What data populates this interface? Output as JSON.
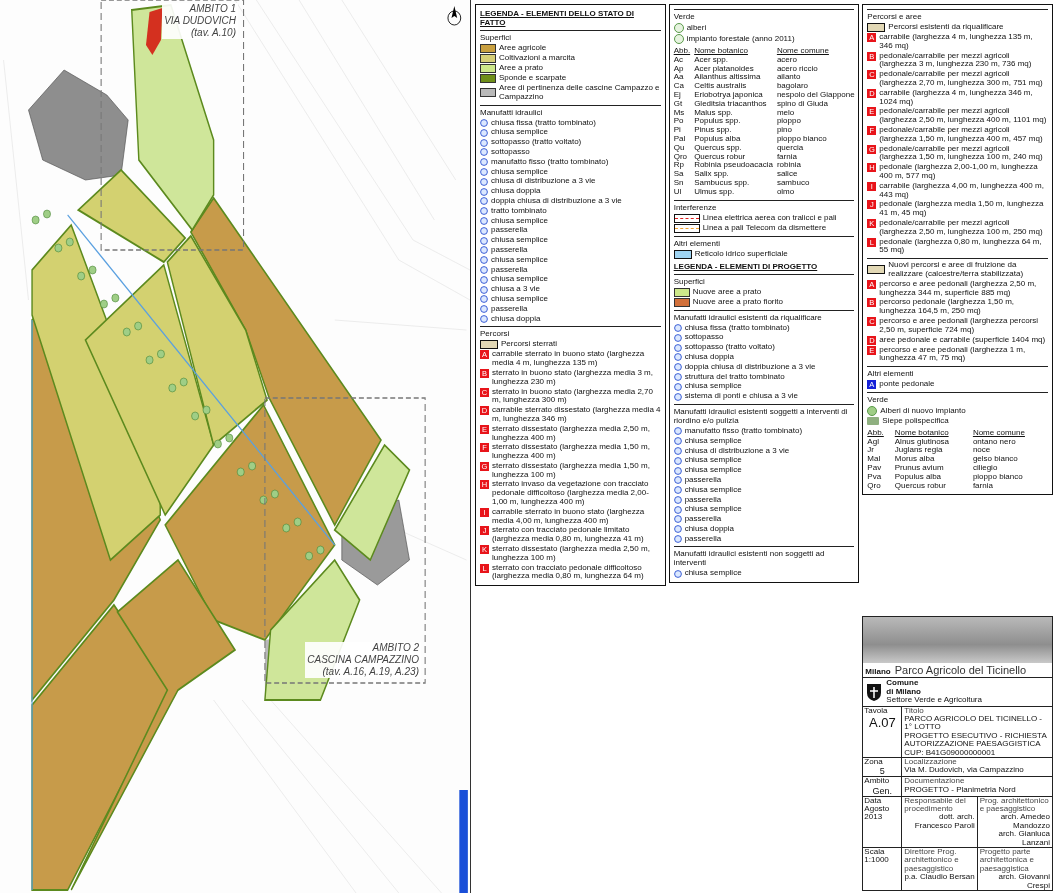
{
  "map": {
    "areas": [
      {
        "label": "AMBITO 1",
        "place": "VIA DUDOVICH",
        "ref": "(tav. A.10)"
      },
      {
        "label": "AMBITO 2",
        "place": "CASCINA CAMPAZZINO",
        "ref": "(tav. A.16, A.19, A.23)"
      }
    ]
  },
  "legend": {
    "columns": [
      {
        "title": "LEGENDA - ELEMENTI DELLO STATO DI FATTO",
        "sections": [
          {
            "heading": "Superfici",
            "kind": "swatches",
            "items": [
              {
                "text": "Aree agricole",
                "color": "#c9a040"
              },
              {
                "text": "Coltivazioni a marcita",
                "color": "#d6cf78"
              },
              {
                "text": "Aree a prato",
                "color": "#cde88a"
              },
              {
                "text": "Sponde e scarpate",
                "color": "#6f8f1a"
              },
              {
                "text": "Aree di pertinenza delle cascine Campazzo e Campazzino",
                "color": "#b9b9b9"
              }
            ]
          },
          {
            "heading": "Manufatti idraulici",
            "kind": "symbols",
            "items": [
              {
                "text": "chiusa fissa (tratto tombinato)"
              },
              {
                "text": "chiusa semplice"
              },
              {
                "text": "sottopasso (tratto voltato)"
              },
              {
                "text": "sottopasso"
              },
              {
                "text": "manufatto fisso (tratto tombinato)"
              },
              {
                "text": "chiusa semplice"
              },
              {
                "text": "chiusa di distribuzione a 3 vie"
              },
              {
                "text": "chiusa doppia"
              },
              {
                "text": "doppia chiusa di distribuzione a 3 vie"
              },
              {
                "text": "tratto tombinato"
              },
              {
                "text": "chiusa semplice"
              },
              {
                "text": "passerella"
              },
              {
                "text": "chiusa semplice"
              },
              {
                "text": "passerella"
              },
              {
                "text": "chiusa semplice"
              },
              {
                "text": "passerella"
              },
              {
                "text": "chiusa semplice"
              },
              {
                "text": "chiusa a 3 vie"
              },
              {
                "text": "chiusa semplice"
              },
              {
                "text": "passerella"
              },
              {
                "text": "chiusa doppia"
              }
            ]
          },
          {
            "heading": "Percorsi",
            "kind": "paths",
            "swatch": "Percorsi sterrati",
            "items": [
              {
                "letter": "A",
                "text": "carrabile sterrato in buono stato (larghezza media 4 m, lunghezza 135 m)"
              },
              {
                "letter": "B",
                "text": "sterrato in buono stato (larghezza media 3 m, lunghezza 230 m)"
              },
              {
                "letter": "C",
                "text": "sterrato in buono stato (larghezza media 2,70 m, lunghezza 300 m)"
              },
              {
                "letter": "D",
                "text": "carrabile sterrato dissestato (larghezza media 4 m, lunghezza 346 m)"
              },
              {
                "letter": "E",
                "text": "sterrato dissestato (larghezza media 2,50 m, lunghezza 400 m)"
              },
              {
                "letter": "F",
                "text": "sterrato dissestato (larghezza media 1,50 m, lunghezza 400 m)"
              },
              {
                "letter": "G",
                "text": "sterrato dissestato (larghezza media 1,50 m, lunghezza 100 m)"
              },
              {
                "letter": "H",
                "text": "sterrato invaso da vegetazione con tracciato pedonale difficoltoso (larghezza media 2,00-1,00 m, lunghezza 400 m)"
              },
              {
                "letter": "I",
                "text": "carrabile sterrato in buono stato (larghezza media 4,00 m, lunghezza 400 m)"
              },
              {
                "letter": "J",
                "text": "sterrato con tracciato pedonale limitato (larghezza media 0,80 m, lunghezza 41 m)"
              },
              {
                "letter": "K",
                "text": "sterrato dissestato (larghezza media 2,50 m, lunghezza 100 m)"
              },
              {
                "letter": "L",
                "text": "sterrato con tracciato pedonale difficoltoso (larghezza media 0,80 m, lunghezza 64 m)"
              }
            ]
          },
          {
            "heading": "Verde",
            "kind": "trees",
            "items": [
              {
                "text": "alberi"
              },
              {
                "text": "impianto forestale (anno 2011)"
              }
            ],
            "table": {
              "columns": [
                "Abb.",
                "Nome botanico",
                "Nome comune"
              ],
              "rows": [
                [
                  "Ac",
                  "Acer spp.",
                  "acero"
                ],
                [
                  "Ap",
                  "Acer platanoides",
                  "acero riccio"
                ],
                [
                  "Aa",
                  "Ailanthus altissima",
                  "ailanto"
                ],
                [
                  "Ca",
                  "Celtis australis",
                  "bagolaro"
                ],
                [
                  "Ej",
                  "Eriobotrya japonica",
                  "nespolo del Giappone"
                ],
                [
                  "Gt",
                  "Gleditsia triacanthos",
                  "spino di Giuda"
                ],
                [
                  "Ms",
                  "Malus spp.",
                  "melo"
                ],
                [
                  "Po",
                  "Populus spp.",
                  "pioppo"
                ],
                [
                  "Pi",
                  "Pinus spp.",
                  "pino"
                ],
                [
                  "Pal",
                  "Populus alba",
                  "pioppo bianco"
                ],
                [
                  "Qu",
                  "Quercus spp.",
                  "quercia"
                ],
                [
                  "Qro",
                  "Quercus robur",
                  "farnia"
                ],
                [
                  "Rp",
                  "Robinia pseudoacacia",
                  "robinia"
                ],
                [
                  "Sa",
                  "Salix spp.",
                  "salice"
                ],
                [
                  "Sn",
                  "Sambucus spp.",
                  "sambuco"
                ],
                [
                  "Ul",
                  "Ulmus spp.",
                  "olmo"
                ]
              ]
            }
          },
          {
            "heading": "Interferenze",
            "kind": "lines",
            "items": [
              {
                "text": "Linea elettrica aerea con tralicci e pali",
                "color": "#e02020"
              },
              {
                "text": "Linea a pali Telecom da dismettere",
                "color": "#f0a030"
              }
            ]
          },
          {
            "heading": "Altri elementi",
            "kind": "water",
            "items": [
              {
                "text": "Reticolo idrico superficiale"
              }
            ]
          }
        ]
      },
      {
        "title": "LEGENDA - ELEMENTI DI PROGETTO",
        "sections": [
          {
            "heading": "Superfici",
            "kind": "swatches",
            "items": [
              {
                "text": "Nuove aree a prato",
                "color": "#cde88a"
              },
              {
                "text": "Nuove aree a prato fiorito",
                "color": "#d2703a"
              }
            ]
          },
          {
            "heading": "Manufatti idraulici esistenti da riqualificare",
            "kind": "symbols",
            "items": [
              {
                "text": "chiusa fissa (tratto tombinato)"
              },
              {
                "text": "sottopasso"
              },
              {
                "text": "sottopasso (tratto voltato)"
              },
              {
                "text": "chiusa doppia"
              },
              {
                "text": "doppia chiusa di distribuzione a 3 vie"
              },
              {
                "text": "struttura del tratto tombinato"
              },
              {
                "text": "chiusa semplice"
              },
              {
                "text": "sistema di ponti e chiusa a 3 vie"
              }
            ]
          },
          {
            "heading": "Manufatti idraulici esistenti soggetti a interventi di riordino e/o pulizia",
            "kind": "symbols",
            "items": [
              {
                "text": "manufatto fisso (tratto tombinato)"
              },
              {
                "text": "chiusa semplice"
              },
              {
                "text": "chiusa di distribuzione a 3 vie"
              },
              {
                "text": "chiusa semplice"
              },
              {
                "text": "chiusa semplice"
              },
              {
                "text": "passerella"
              },
              {
                "text": "chiusa semplice"
              },
              {
                "text": "passerella"
              },
              {
                "text": "chiusa semplice"
              },
              {
                "text": "passerella"
              },
              {
                "text": "chiusa doppia"
              },
              {
                "text": "passerella"
              }
            ]
          },
          {
            "heading": "Manufatti idraulici esistenti non soggetti ad interventi",
            "kind": "symbols",
            "items": [
              {
                "text": "chiusa semplice"
              }
            ]
          },
          {
            "heading": "Percorsi e aree",
            "kind": "paths",
            "swatch": "Percorsi esistenti da riqualificare",
            "items": [
              {
                "letter": "A",
                "text": "carrabile (larghezza 4 m, lunghezza 135 m, 346 mq)"
              },
              {
                "letter": "B",
                "text": "pedonale/carrabile per mezzi agricoli (larghezza 3 m, lunghezza 230 m, 736 mq)"
              },
              {
                "letter": "C",
                "text": "pedonale/carrabile per mezzi agricoli (larghezza 2,70 m, lunghezza 300 m, 751 mq)"
              },
              {
                "letter": "D",
                "text": "carrabile (larghezza 4 m, lunghezza 346 m, 1024 mq)"
              },
              {
                "letter": "E",
                "text": "pedonale/carrabile per mezzi agricoli (larghezza 2,50 m, lunghezza 400 m, 1101 mq)"
              },
              {
                "letter": "F",
                "text": "pedonale/carrabile per mezzi agricoli (larghezza 1,50 m, lunghezza 400 m, 457 mq)"
              },
              {
                "letter": "G",
                "text": "pedonale/carrabile per mezzi agricoli (larghezza 1,50 m, lunghezza 100 m, 240 mq)"
              },
              {
                "letter": "H",
                "text": "pedonale (larghezza 2,00-1,00 m, lunghezza 400 m, 577 mq)"
              },
              {
                "letter": "I",
                "text": "carrabile (larghezza 4,00 m, lunghezza 400 m, 443 mq)"
              },
              {
                "letter": "J",
                "text": "pedonale (larghezza media 1,50 m, lunghezza 41 m, 45 mq)"
              },
              {
                "letter": "K",
                "text": "pedonale/carrabile per mezzi agricoli (larghezza 2,50 m, lunghezza 100 m, 250 mq)"
              },
              {
                "letter": "L",
                "text": "pedonale (larghezza 0,80 m, lunghezza 64 m, 55 mq)"
              }
            ]
          },
          {
            "kind": "paths",
            "swatch": "Nuovi percorsi e aree di fruizione da realizzare (calcestre/terra stabilizzata)",
            "items": [
              {
                "letter": "A",
                "text": "percorso e aree pedonali (larghezza 2,50 m, lunghezza 344 m, superficie 885 mq)"
              },
              {
                "letter": "B",
                "text": "percorso pedonale (larghezza 1,50 m, lunghezza 164,5 m, 250 mq)"
              },
              {
                "letter": "C",
                "text": "percorso e aree pedonali (larghezza percorsi 2,50 m, superficie 724 mq)"
              },
              {
                "letter": "D",
                "text": "aree pedonale e carrabile (superficie 1404 mq)"
              },
              {
                "letter": "E",
                "text": "percorso e aree pedonali (larghezza 1 m, lunghezza 47 m, 75 mq)"
              }
            ]
          },
          {
            "heading": "Altri elementi",
            "kind": "bridge",
            "items": [
              {
                "letter": "A",
                "text": "ponte pedonale"
              }
            ]
          },
          {
            "heading": "Verde",
            "kind": "newtrees",
            "items": [
              {
                "text": "Alberi di nuovo impianto"
              },
              {
                "text": "Siepe polispecifica"
              }
            ],
            "table": {
              "columns": [
                "Abb.",
                "Nome botanico",
                "Nome comune"
              ],
              "rows": [
                [
                  "Agl",
                  "Alnus glutinosa",
                  "ontano nero"
                ],
                [
                  "Jr",
                  "Juglans regia",
                  "noce"
                ],
                [
                  "Mal",
                  "Morus alba",
                  "gelso bianco"
                ],
                [
                  "Pav",
                  "Prunus avium",
                  "ciliegio"
                ],
                [
                  "Pva",
                  "Populus alba",
                  "pioppo bianco"
                ],
                [
                  "Qro",
                  "Quercus robur",
                  "farnia"
                ]
              ]
            }
          }
        ]
      }
    ]
  },
  "title_block": {
    "city": "Milano",
    "project": "Parco Agricolo del Ticinello",
    "office": [
      "Comune",
      "di Milano",
      "Settore Verde e Agricoltura"
    ],
    "rows": [
      {
        "label": "Tavola",
        "code": "A.07",
        "caption": "Titolo",
        "lines": [
          "PARCO AGRICOLO DEL TICINELLO - 1° LOTTO",
          "PROGETTO ESECUTIVO - RICHIESTA AUTORIZZAZIONE PAESAGGISTICA",
          "CUP: B41G09000000001"
        ]
      },
      {
        "label": "Zona",
        "code": "5",
        "caption": "Localizzazione",
        "lines": [
          "Via M. Dudovich, via Campazzino"
        ]
      },
      {
        "label": "Ambito",
        "code": "Gen.",
        "caption": "Documentazione",
        "lines": [
          "PROGETTO - Planimetria Nord"
        ]
      }
    ],
    "info": [
      {
        "label": "Data",
        "value": "Agosto 2013",
        "role": "Responsabile del procedimento",
        "name": "dott. arch. Francesco Paroli",
        "role2": "Prog. architettonico e paesaggistico",
        "names2": [
          "arch. Amedeo Mandozzo",
          "arch. Gianluca Lanzani"
        ]
      },
      {
        "label": "Scala",
        "value": "1:1000",
        "role": "Direttore Prog. architettonico e paesaggistico",
        "name": "p.a. Claudio Bersan",
        "role2": "Progetto parte architettonica e paesaggistica",
        "names2": [
          "arch. Giovanni Crespi"
        ]
      }
    ]
  }
}
